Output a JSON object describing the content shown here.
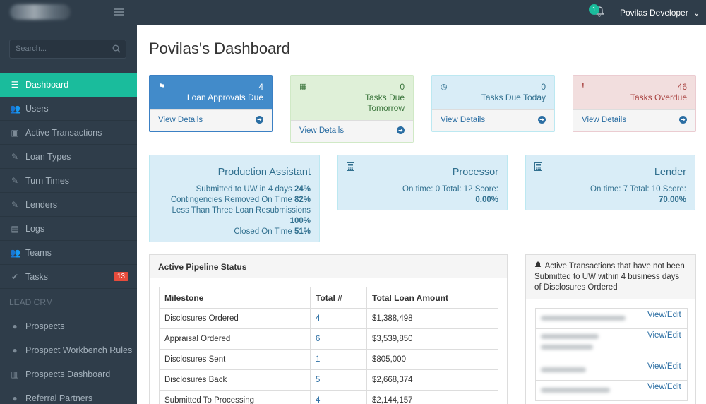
{
  "header": {
    "notification_count": "1",
    "user_name": "Povilas Developer",
    "user_chevron": "⌄"
  },
  "sidebar": {
    "search_placeholder": "Search...",
    "items": [
      {
        "label": "Dashboard",
        "icon": "database-icon",
        "glyph": "☰",
        "active": true
      },
      {
        "label": "Users",
        "icon": "users-icon",
        "glyph": "👥"
      },
      {
        "label": "Active Transactions",
        "icon": "money-icon",
        "glyph": "▣"
      },
      {
        "label": "Loan Types",
        "icon": "edit-icon",
        "glyph": "✎"
      },
      {
        "label": "Turn Times",
        "icon": "edit-icon",
        "glyph": "✎"
      },
      {
        "label": "Lenders",
        "icon": "edit-icon",
        "glyph": "✎"
      },
      {
        "label": "Logs",
        "icon": "book-icon",
        "glyph": "▤"
      },
      {
        "label": "Teams",
        "icon": "users-icon",
        "glyph": "👥"
      },
      {
        "label": "Tasks",
        "icon": "check-icon",
        "glyph": "✔",
        "badge": "13"
      }
    ],
    "section_label": "LEAD CRM",
    "crm_items": [
      {
        "label": "Prospects",
        "icon": "user-icon",
        "glyph": "●"
      },
      {
        "label": "Prospect Workbench Rules",
        "icon": "user-icon",
        "glyph": "●"
      },
      {
        "label": "Prospects Dashboard",
        "icon": "bar-chart-icon",
        "glyph": "▥"
      },
      {
        "label": "Referral Partners",
        "icon": "user-icon",
        "glyph": "●"
      }
    ]
  },
  "page": {
    "title": "Povilas's Dashboard"
  },
  "stats": [
    {
      "count": "4",
      "label": "Loan Approvals Due",
      "link": "View Details",
      "icon": "flag-icon",
      "glyph": "⚑"
    },
    {
      "count": "0",
      "label": "Tasks Due Tomorrow",
      "link": "View Details",
      "icon": "calendar-icon",
      "glyph": "▦"
    },
    {
      "count": "0",
      "label": "Tasks Due Today",
      "link": "View Details",
      "icon": "clock-icon",
      "glyph": "◷"
    },
    {
      "count": "46",
      "label": "Tasks Overdue",
      "link": "View Details",
      "icon": "exclamation-icon",
      "glyph": "!"
    }
  ],
  "production_assistant": {
    "title": "Production Assistant",
    "lines": [
      {
        "text": "Submitted to UW in 4 days ",
        "value": "24%"
      },
      {
        "text": "Contingencies Removed On Time ",
        "value": "82%"
      },
      {
        "text": "Less Than Three Loan Resubmissions",
        "value": ""
      },
      {
        "text": "",
        "value": "100%"
      },
      {
        "text": "Closed On Time ",
        "value": "51%"
      }
    ]
  },
  "processor": {
    "title": "Processor",
    "line": "On time: 0 Total: 12 Score:",
    "score": "0.00%",
    "icon": "calculator-icon"
  },
  "lender": {
    "title": "Lender",
    "line": "On time: 7 Total: 10 Score:",
    "score": "70.00%",
    "icon": "calculator-icon"
  },
  "pipeline": {
    "title": "Active Pipeline Status",
    "columns": [
      "Milestone",
      "Total #",
      "Total Loan Amount"
    ],
    "rows": [
      {
        "milestone": "Disclosures Ordered",
        "total": "4",
        "amount": "$1,388,498"
      },
      {
        "milestone": "Appraisal Ordered",
        "total": "6",
        "amount": "$3,539,850"
      },
      {
        "milestone": "Disclosures Sent",
        "total": "1",
        "amount": "$805,000"
      },
      {
        "milestone": "Disclosures Back",
        "total": "5",
        "amount": "$2,668,374"
      },
      {
        "milestone": "Submitted To Processing",
        "total": "4",
        "amount": "$2,144,157"
      }
    ]
  },
  "uw_panel": {
    "title": "Active Transactions that have not been Submitted to UW within 4 business days of Disclosures Ordered",
    "action": "View/Edit",
    "icon": "bell-icon"
  }
}
